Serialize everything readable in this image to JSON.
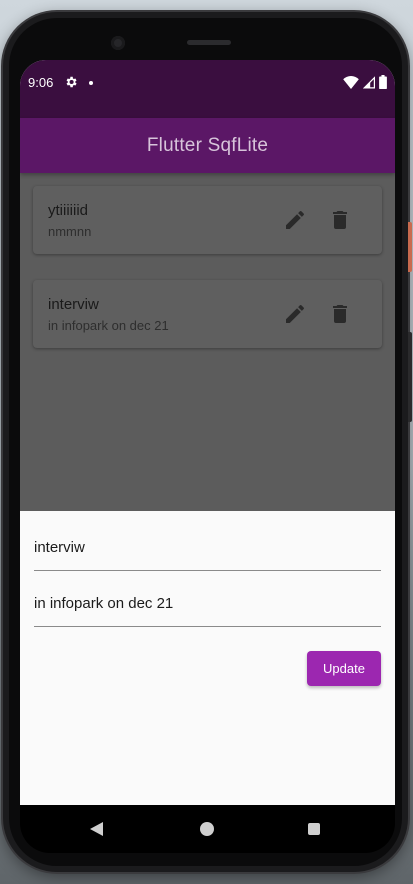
{
  "status_bar": {
    "time": "9:06",
    "icons": [
      "settings-icon",
      "notification-dot-icon",
      "wifi-icon",
      "signal-icon",
      "battery-icon"
    ]
  },
  "app_bar": {
    "title": "Flutter SqfLite"
  },
  "notes": [
    {
      "title": "ytiiiiiid",
      "description": "nmmnn"
    },
    {
      "title": "interviw",
      "description": "in infopark on dec 21"
    }
  ],
  "card_actions": {
    "edit_icon": "edit-pencil-icon",
    "delete_icon": "trash-icon"
  },
  "sheet": {
    "title_value": "interviw",
    "description_value": "in infopark on dec 21",
    "update_label": "Update"
  },
  "nav_bar": {
    "icons": [
      "back-icon",
      "home-icon",
      "recents-icon"
    ]
  },
  "colors": {
    "status_bar": "#3a0e3f",
    "app_bar": "#5b1766",
    "accent": "#9c27b0",
    "scrim": "#5c5c5c"
  }
}
